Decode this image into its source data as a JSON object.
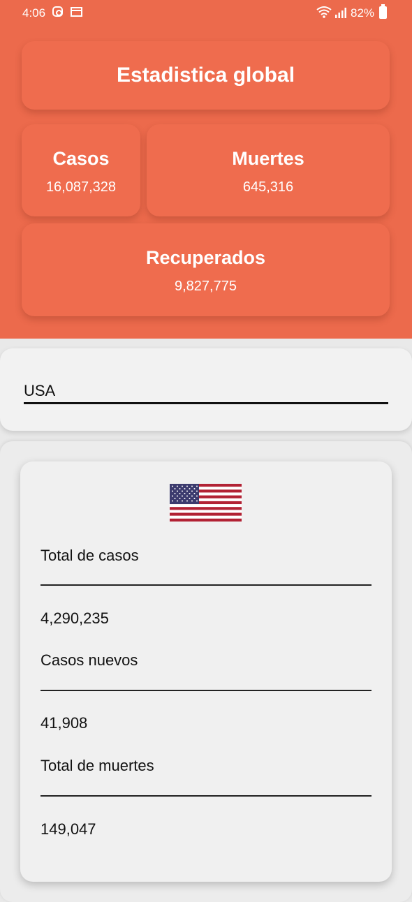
{
  "status_bar": {
    "time": "4:06",
    "battery": "82%",
    "icons": [
      "instagram-icon",
      "calendar-icon",
      "wifi-icon",
      "signal-icon",
      "battery-icon"
    ]
  },
  "global": {
    "title": "Estadistica global",
    "cases_label": "Casos",
    "cases_value": "16,087,328",
    "deaths_label": "Muertes",
    "deaths_value": "645,316",
    "recovered_label": "Recuperados",
    "recovered_value": "9,827,775"
  },
  "search": {
    "value": "USA"
  },
  "country": {
    "flag": "us-flag",
    "total_cases_label": "Total de casos",
    "total_cases_value": "4,290,235",
    "new_cases_label": "Casos nuevos",
    "new_cases_value": "41,908",
    "total_deaths_label": "Total de muertes",
    "total_deaths_value": "149,047"
  },
  "colors": {
    "accent": "#ec6a4c",
    "card": "#ef6c4e",
    "background": "#ececec"
  }
}
